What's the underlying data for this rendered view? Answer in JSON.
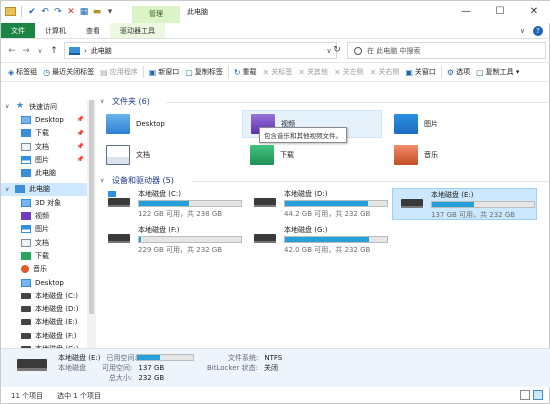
{
  "window": {
    "title": "此电脑",
    "context_tab_group": "管理",
    "minimize": "—",
    "maximize": "☐",
    "close": "✕"
  },
  "quick_access_toolbar": {
    "icons": [
      "folder-icon",
      "check-icon",
      "undo-icon",
      "redo-icon",
      "delete-icon",
      "properties-icon",
      "new-folder-icon",
      "dropdown-icon"
    ],
    "glyphs": [
      "✔",
      "↶",
      "↷",
      "✕",
      "▦",
      "▬",
      "▾"
    ]
  },
  "ribbon_tabs": {
    "file": "文件",
    "tabs": [
      "计算机",
      "查看",
      "驱动器工具"
    ],
    "collapse": "∨",
    "help": "?"
  },
  "address_bar": {
    "back": "←",
    "forward": "→",
    "dropdown": "∨",
    "up": "↑",
    "separator": "›",
    "path": "此电脑",
    "caret": "∨",
    "refresh": "↻",
    "search_placeholder": "在 此电脑 中搜索"
  },
  "toolbar": {
    "items": [
      {
        "icon": "tag-icon",
        "glyph": "◈",
        "label": "标签组",
        "enabled": true
      },
      {
        "icon": "recent-tags-icon",
        "glyph": "◷",
        "label": "最近关闭标签",
        "enabled": true
      },
      {
        "icon": "apps-icon",
        "glyph": "▤",
        "label": "应用程序",
        "enabled": false
      },
      {
        "icon": "new-window-icon",
        "glyph": "▣",
        "label": "新窗口",
        "enabled": true
      },
      {
        "icon": "copy-tag-icon",
        "glyph": "▢",
        "label": "复制标签",
        "enabled": true
      },
      {
        "icon": "reopen-icon",
        "glyph": "↻",
        "label": "重载",
        "enabled": true
      },
      {
        "icon": "close-left-icon",
        "glyph": "✕",
        "label": "关标签",
        "enabled": false
      },
      {
        "icon": "close-others-icon",
        "glyph": "✕",
        "label": "关其他",
        "enabled": false
      },
      {
        "icon": "close-left-side-icon",
        "glyph": "✕",
        "label": "关左侧",
        "enabled": false
      },
      {
        "icon": "close-right-side-icon",
        "glyph": "✕",
        "label": "关右侧",
        "enabled": false
      },
      {
        "icon": "close-window-icon",
        "glyph": "▣",
        "label": "关窗口",
        "enabled": true
      },
      {
        "icon": "options-icon",
        "glyph": "⚙",
        "label": "选项",
        "enabled": true
      },
      {
        "icon": "copy-tool-icon",
        "glyph": "▢",
        "label": "复制工具 ▾",
        "enabled": true
      }
    ]
  },
  "sidebar": {
    "quick_access_label": "快速访问",
    "quick_items": [
      "Desktop",
      "下载",
      "文档",
      "图片",
      "此电脑"
    ],
    "pin_glyph": "📌",
    "this_pc_label": "此电脑",
    "pc_items": [
      "3D 对象",
      "视频",
      "图片",
      "文档",
      "下载",
      "音乐",
      "Desktop",
      "本地磁盘 (C:)",
      "本地磁盘 (D:)",
      "本地磁盘 (E:)",
      "本地磁盘 (F:)",
      "本地磁盘 (G:)"
    ]
  },
  "folders_group": {
    "header": "文件夹 (6)",
    "items": [
      "Desktop",
      "视频",
      "图片",
      "文档",
      "下载",
      "音乐"
    ],
    "tooltip": "包含音乐和其他视频文件。"
  },
  "drives_group": {
    "header": "设备和驱动器 (5)",
    "drives": [
      {
        "name": "本地磁盘 (C:)",
        "free_text": "122 GB 可用，共 238 GB",
        "used_fraction": 0.49
      },
      {
        "name": "本地磁盘 (D:)",
        "free_text": "44.2 GB 可用，共 232 GB",
        "used_fraction": 0.81
      },
      {
        "name": "本地磁盘 (E:)",
        "free_text": "137 GB 可用，共 232 GB",
        "used_fraction": 0.41
      },
      {
        "name": "本地磁盘 (F:)",
        "free_text": "229 GB 可用，共 232 GB",
        "used_fraction": 0.02
      },
      {
        "name": "本地磁盘 (G:)",
        "free_text": "42.0 GB 可用，共 232 GB",
        "used_fraction": 0.82
      }
    ]
  },
  "details_pane": {
    "drive_name": "本地磁盘 (E:)",
    "type": "本地磁盘",
    "used_label": "已用空间:",
    "free_label": "可用空间:",
    "free_value": "137 GB",
    "total_label": "总大小:",
    "total_value": "232 GB",
    "used_fraction": 0.41,
    "fs_label": "文件系统:",
    "fs_value": "NTFS",
    "bitlocker_label": "BitLocker 状态:",
    "bitlocker_value": "关闭"
  },
  "status_bar": {
    "item_count": "11 个项目",
    "selected": "选中 1 个项目"
  }
}
